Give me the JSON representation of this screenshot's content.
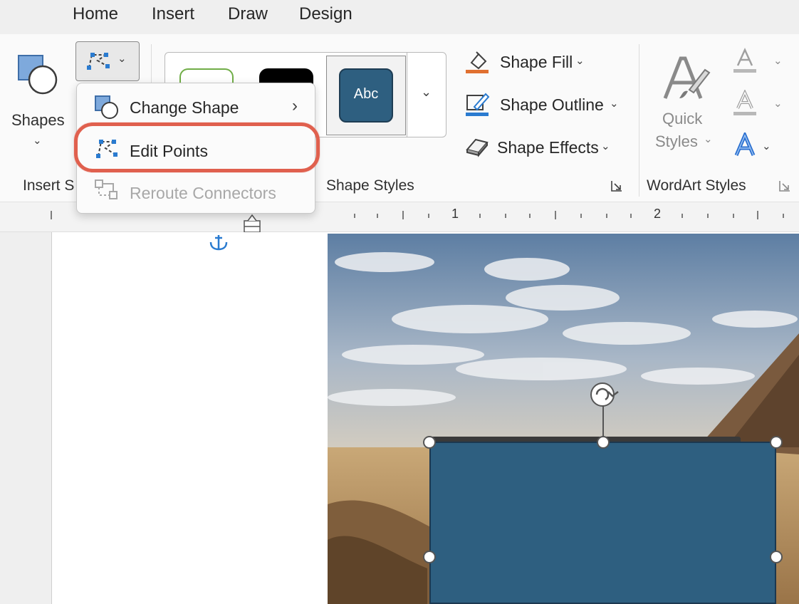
{
  "tabs": [
    {
      "label": "Home"
    },
    {
      "label": "Insert"
    },
    {
      "label": "Draw"
    },
    {
      "label": "Design"
    }
  ],
  "ribbon": {
    "shapes_label": "Shapes",
    "insert_shapes_group": "Insert S",
    "shape_styles_group": "Shape Styles",
    "wordart_styles_group": "WordArt Styles",
    "gallery_selected_text": "Abc",
    "shape_fill": "Shape Fill",
    "shape_outline": "Shape Outline",
    "shape_effects": "Shape Effects",
    "quick_styles_line1": "Quick",
    "quick_styles_line2": "Styles"
  },
  "menu": {
    "items": [
      {
        "label": "Change Shape",
        "enabled": true,
        "has_submenu": true
      },
      {
        "label": "Edit Points",
        "enabled": true,
        "highlighted": true
      },
      {
        "label": "Reroute Connectors",
        "enabled": false
      }
    ]
  },
  "ruler": {
    "marks": [
      "1",
      "2"
    ]
  },
  "colors": {
    "accent_shape": "#2e5f80",
    "highlight": "#e0604e",
    "fill_underline": "#e07030",
    "outline_icon": "#2a7bd0",
    "wordart_blue": "#2a6fd0"
  },
  "icons": [
    "shapes-icon",
    "edit-shape-icon",
    "change-shape-icon",
    "edit-points-icon",
    "reroute-connectors-icon",
    "shape-fill-icon",
    "shape-outline-icon",
    "shape-effects-icon",
    "quick-styles-icon",
    "text-fill-icon",
    "text-outline-icon",
    "text-effects-icon",
    "anchor-icon",
    "rotate-handle-icon",
    "dialog-launcher-icon"
  ]
}
